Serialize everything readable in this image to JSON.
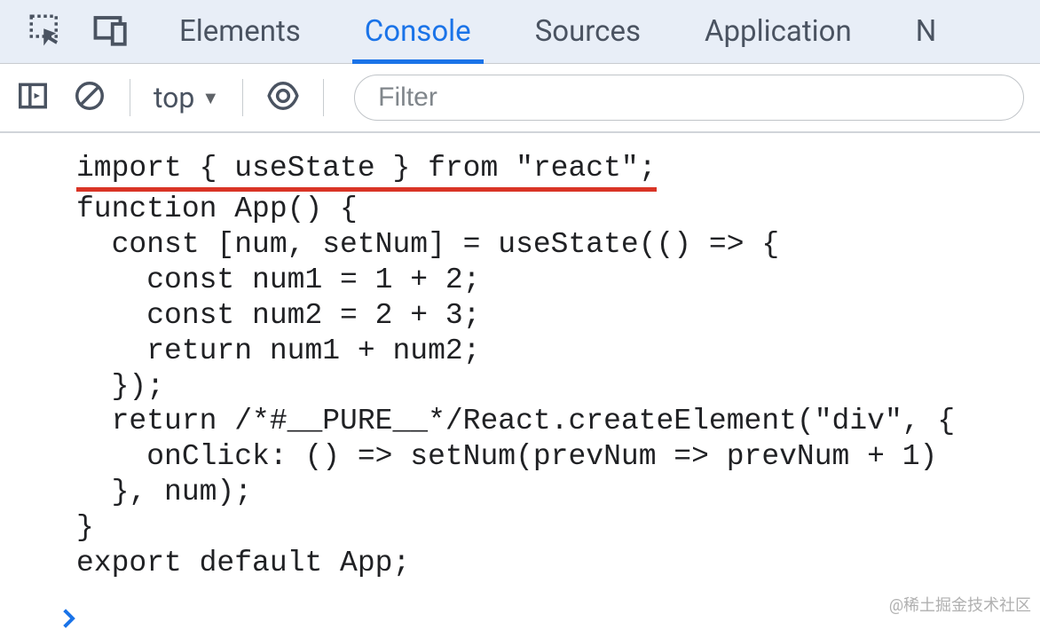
{
  "tabs": {
    "elements": "Elements",
    "console": "Console",
    "sources": "Sources",
    "application": "Application",
    "next_partial": "N"
  },
  "toolbar": {
    "context": "top",
    "filter_placeholder": "Filter"
  },
  "code": {
    "line1": "import { useState } from \"react\";",
    "line2": "function App() {",
    "line3": "  const [num, setNum] = useState(() => {",
    "line4": "    const num1 = 1 + 2;",
    "line5": "    const num2 = 2 + 3;",
    "line6": "    return num1 + num2;",
    "line7": "  });",
    "line8": "  return /*#__PURE__*/React.createElement(\"div\", {",
    "line9": "    onClick: () => setNum(prevNum => prevNum + 1)",
    "line10": "  }, num);",
    "line11": "}",
    "line12": "export default App;"
  },
  "watermark": "@稀土掘金技术社区"
}
